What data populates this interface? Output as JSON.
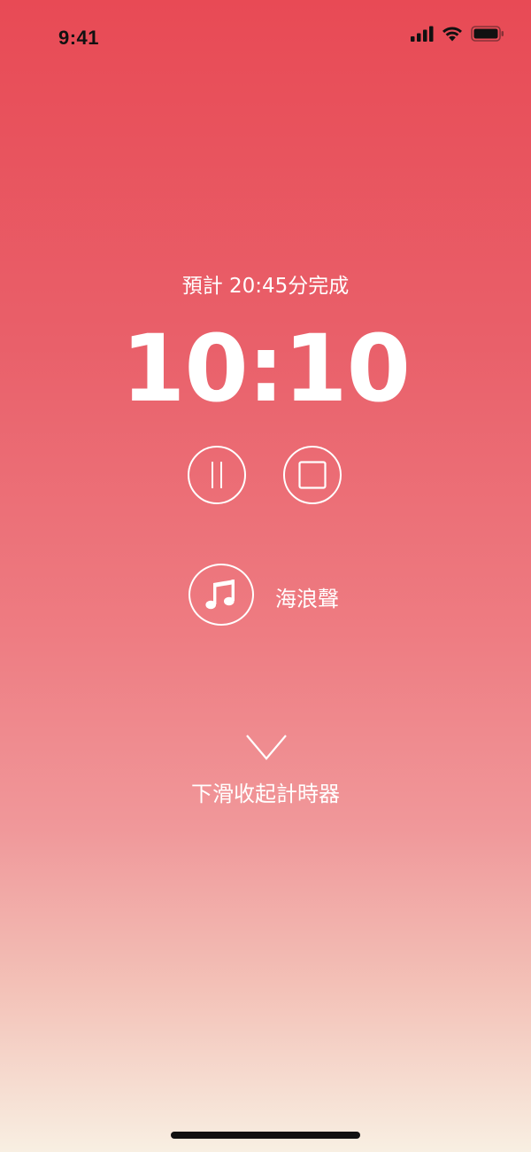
{
  "status_bar": {
    "time": "9:41"
  },
  "timer": {
    "eta_text": "預計 20:45分完成",
    "remaining": "10:10"
  },
  "sound": {
    "label": "海浪聲"
  },
  "collapse": {
    "hint": "下滑收起計時器"
  },
  "icons": {
    "pause": "pause-icon",
    "stop": "stop-icon",
    "music": "music-note-icon",
    "chevron": "chevron-down-icon"
  },
  "colors": {
    "gradient_top": "#e84a55",
    "gradient_bottom": "#f8efe2",
    "foreground": "#ffffff",
    "status_text": "#111111"
  }
}
